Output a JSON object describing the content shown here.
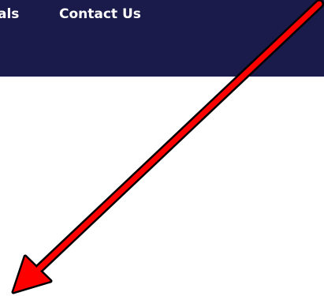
{
  "nav": {
    "items": [
      {
        "label": "als"
      },
      {
        "label": "Contact Us"
      }
    ]
  },
  "colors": {
    "nav_background": "#1b1b4b",
    "nav_text": "#ffffff",
    "page_background": "#ffffff",
    "arrow": "#ff0000",
    "arrow_outline": "#000000"
  },
  "annotation": {
    "icon": "arrow-down-left-icon"
  }
}
